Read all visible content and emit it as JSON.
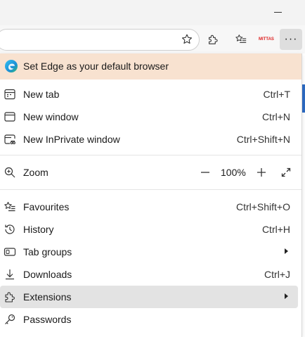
{
  "toolbar": {
    "mittas_label": "MITTAS",
    "more_label": "···"
  },
  "menu": {
    "banner": "Set Edge as your default browser",
    "new_tab": {
      "label": "New tab",
      "shortcut": "Ctrl+T"
    },
    "new_window": {
      "label": "New window",
      "shortcut": "Ctrl+N"
    },
    "new_inprivate": {
      "label": "New InPrivate window",
      "shortcut": "Ctrl+Shift+N"
    },
    "zoom": {
      "label": "Zoom",
      "value": "100%"
    },
    "favourites": {
      "label": "Favourites",
      "shortcut": "Ctrl+Shift+O"
    },
    "history": {
      "label": "History",
      "shortcut": "Ctrl+H"
    },
    "tab_groups": {
      "label": "Tab groups"
    },
    "downloads": {
      "label": "Downloads",
      "shortcut": "Ctrl+J"
    },
    "extensions": {
      "label": "Extensions"
    },
    "passwords": {
      "label": "Passwords"
    }
  },
  "colors": {
    "banner_bg": "#f8e2d0",
    "hover_bg": "#e3e3e3",
    "accent_blue": "#2d6bc4"
  }
}
